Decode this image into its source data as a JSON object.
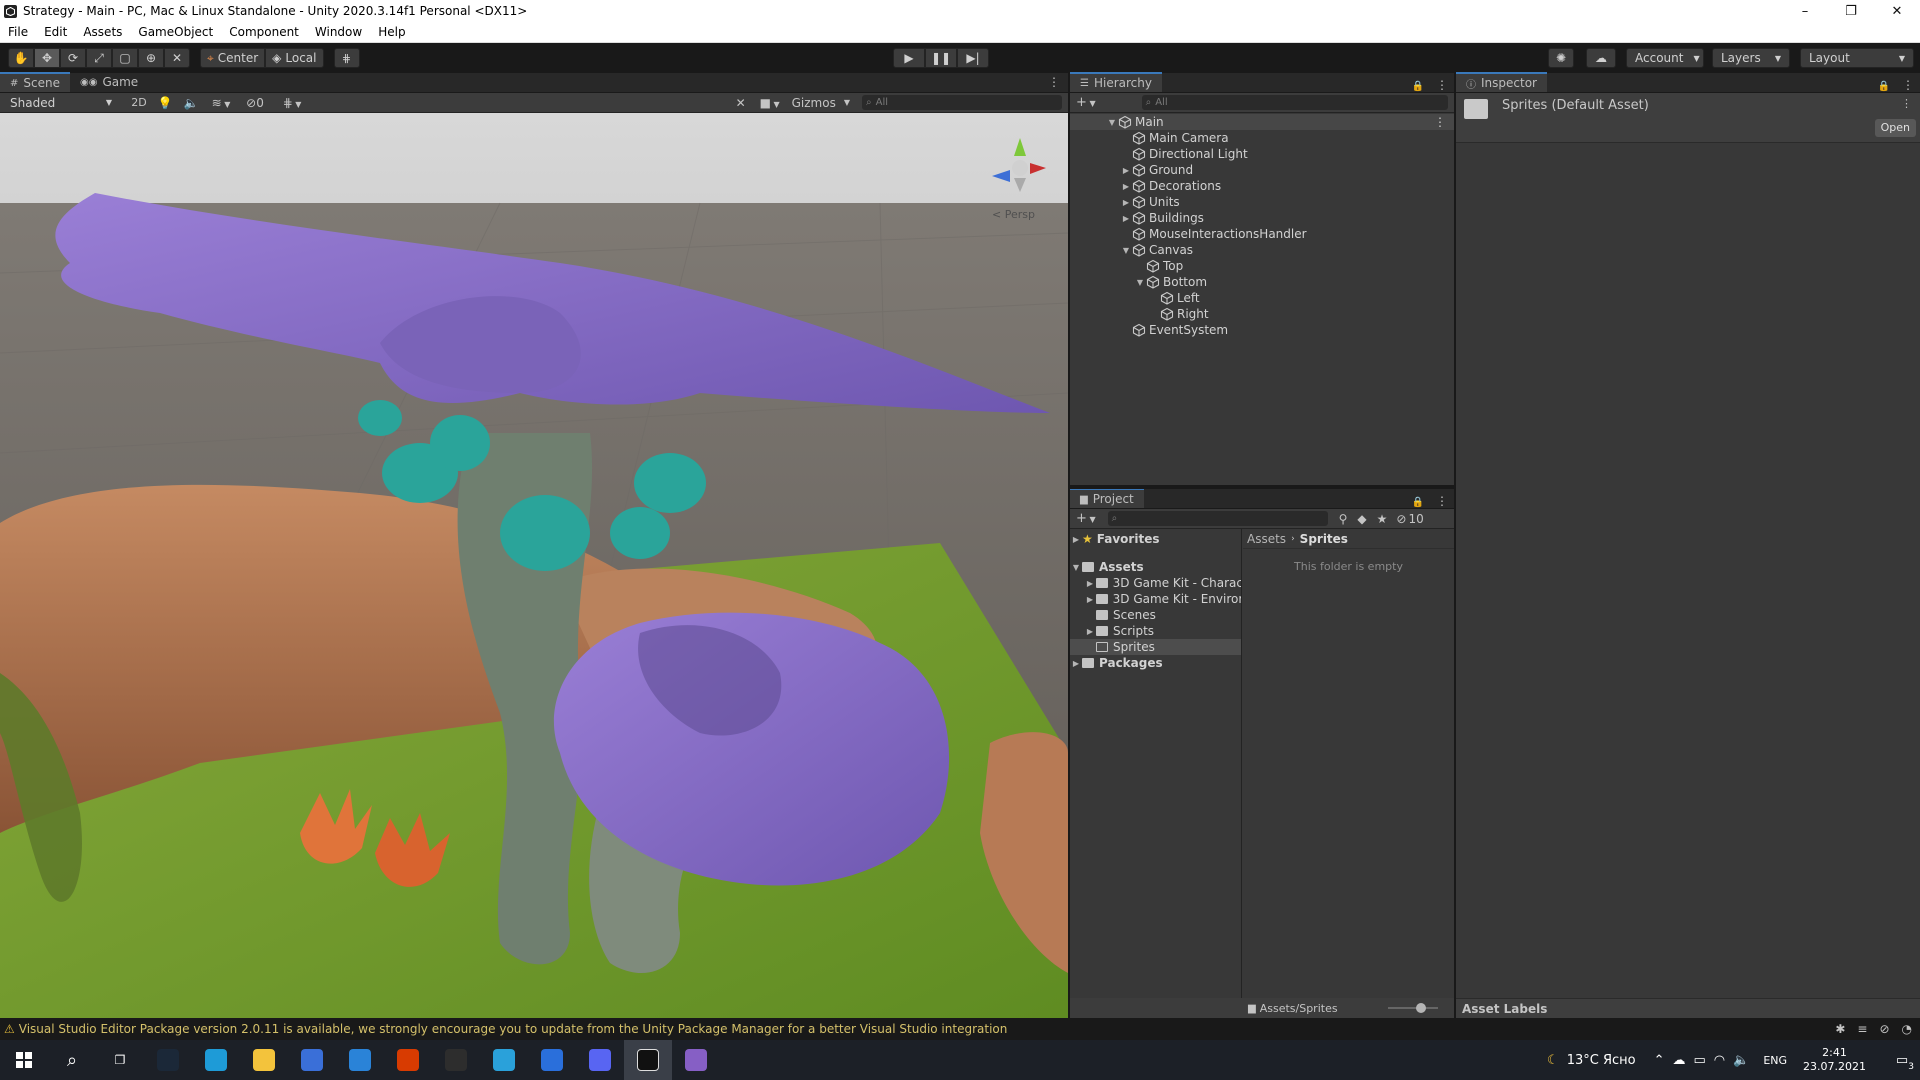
{
  "window": {
    "title": "Strategy - Main - PC, Mac & Linux Standalone - Unity 2020.3.14f1 Personal <DX11>",
    "controls": [
      "–",
      "❐",
      "✕"
    ]
  },
  "menu": [
    "File",
    "Edit",
    "Assets",
    "GameObject",
    "Component",
    "Window",
    "Help"
  ],
  "toolbar": {
    "pivot_label": "Center",
    "space_label": "Local",
    "account_label": "Account",
    "layers_label": "Layers",
    "layout_label": "Layout"
  },
  "scene": {
    "tabs": [
      {
        "label": "Scene",
        "icon": "hash-icon"
      },
      {
        "label": "Game",
        "icon": "gamepad-icon"
      }
    ],
    "draw_mode": "Shaded",
    "mode_2d": "2D",
    "hidden_count": "0",
    "gizmos_label": "Gizmos",
    "search_placeholder": "All",
    "persp_label": "< Persp"
  },
  "hierarchy": {
    "title": "Hierarchy",
    "search_placeholder": "All",
    "items": [
      {
        "label": "Main",
        "depth": 0,
        "arrow": "▼",
        "kind": "scene"
      },
      {
        "label": "Main Camera",
        "depth": 1,
        "arrow": "",
        "kind": "object"
      },
      {
        "label": "Directional Light",
        "depth": 1,
        "arrow": "",
        "kind": "object"
      },
      {
        "label": "Ground",
        "depth": 1,
        "arrow": "▶",
        "kind": "object"
      },
      {
        "label": "Decorations",
        "depth": 1,
        "arrow": "▶",
        "kind": "object"
      },
      {
        "label": "Units",
        "depth": 1,
        "arrow": "▶",
        "kind": "object"
      },
      {
        "label": "Buildings",
        "depth": 1,
        "arrow": "▶",
        "kind": "object"
      },
      {
        "label": "MouseInteractionsHandler",
        "depth": 1,
        "arrow": "",
        "kind": "object"
      },
      {
        "label": "Canvas",
        "depth": 1,
        "arrow": "▼",
        "kind": "object"
      },
      {
        "label": "Top",
        "depth": 2,
        "arrow": "",
        "kind": "object"
      },
      {
        "label": "Bottom",
        "depth": 2,
        "arrow": "▼",
        "kind": "object"
      },
      {
        "label": "Left",
        "depth": 3,
        "arrow": "",
        "kind": "object"
      },
      {
        "label": "Right",
        "depth": 3,
        "arrow": "",
        "kind": "object"
      },
      {
        "label": "EventSystem",
        "depth": 1,
        "arrow": "",
        "kind": "object"
      }
    ]
  },
  "inspector": {
    "title": "Inspector",
    "asset_name": "Sprites (Default Asset)",
    "open_label": "Open",
    "footer_label": "Asset Labels"
  },
  "project": {
    "title": "Project",
    "hidden_count": "10",
    "favorites_label": "Favorites",
    "tree": [
      {
        "label": "Assets",
        "depth": 0,
        "arrow": "▼",
        "bold": true
      },
      {
        "label": "3D Game Kit - Charac",
        "depth": 1,
        "arrow": "▶"
      },
      {
        "label": "3D Game Kit - Enviror",
        "depth": 1,
        "arrow": "▶"
      },
      {
        "label": "Scenes",
        "depth": 1,
        "arrow": ""
      },
      {
        "label": "Scripts",
        "depth": 1,
        "arrow": "▶"
      },
      {
        "label": "Sprites",
        "depth": 1,
        "arrow": "",
        "selected": true
      },
      {
        "label": "Packages",
        "depth": 0,
        "arrow": "▶",
        "bold": true
      }
    ],
    "breadcrumb": [
      "Assets",
      "Sprites"
    ],
    "empty_message": "This folder is empty",
    "footer_path": "Assets/Sprites"
  },
  "status": {
    "message": "Visual Studio Editor Package version 2.0.11 is available, we strongly encourage you to update from the Unity Package Manager for a better Visual Studio integration"
  },
  "taskbar": {
    "weather": "13°C Ясно",
    "lang": "ENG",
    "time": "2:41",
    "date": "23.07.2021",
    "notif_count": "3",
    "apps": [
      {
        "name": "steam-icon",
        "color": "#1b2838"
      },
      {
        "name": "edge-icon",
        "color": "#1e9bd7"
      },
      {
        "name": "explorer-icon",
        "color": "#f3c33c"
      },
      {
        "name": "store-icon",
        "color": "#3a6fd8"
      },
      {
        "name": "mail-icon",
        "color": "#2a83d8"
      },
      {
        "name": "office-icon",
        "color": "#d83b01"
      },
      {
        "name": "epic-icon",
        "color": "#2d2d2d"
      },
      {
        "name": "telegram-icon",
        "color": "#2aa1da"
      },
      {
        "name": "bluestacks-icon",
        "color": "#2a6fdb"
      },
      {
        "name": "discord-icon",
        "color": "#5865f2"
      },
      {
        "name": "unity-icon",
        "color": "#111111"
      },
      {
        "name": "visual-studio-icon",
        "color": "#865fc5"
      }
    ]
  },
  "colors": {
    "accent": "#3a79bb",
    "warning": "#e0b93b",
    "mushroom_cap": "#8a6cc6",
    "grass": "#6f9a2a"
  }
}
